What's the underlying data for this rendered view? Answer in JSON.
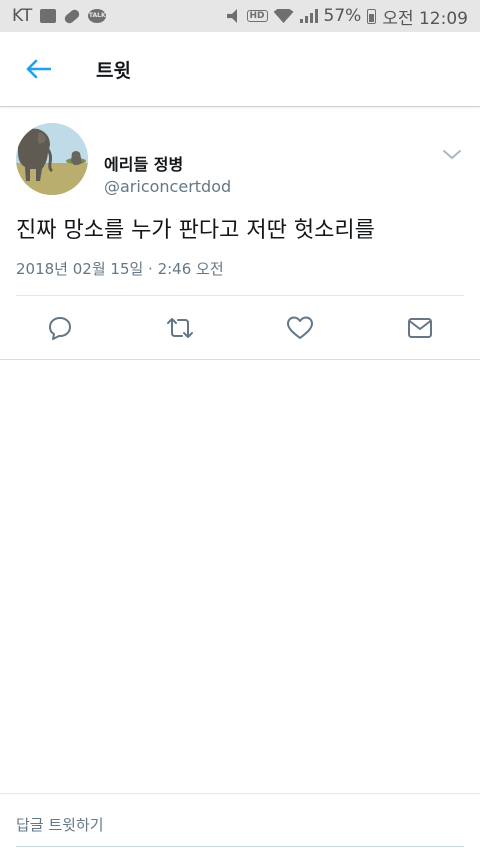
{
  "status_bar": {
    "carrier": "KT",
    "battery": "57%",
    "time": "오전 12:09",
    "hd_label": "HD",
    "talk_label": "TALK"
  },
  "header": {
    "title": "트윗"
  },
  "tweet": {
    "author_name": "에리들 정병",
    "author_handle": "@ariconcertdod",
    "text": "진짜 망소를 누가 판다고 저딴 헛소리를",
    "timestamp": "2018년 02월 15일 · 2:46 오전"
  },
  "actions": [
    "reply-icon",
    "retweet-icon",
    "like-icon",
    "message-icon"
  ],
  "reply_bar": {
    "placeholder": "답글 트윗하기"
  },
  "colors": {
    "accent": "#1da1f2",
    "icon": "#657786",
    "text": "#14171a",
    "muted": "#657786"
  }
}
